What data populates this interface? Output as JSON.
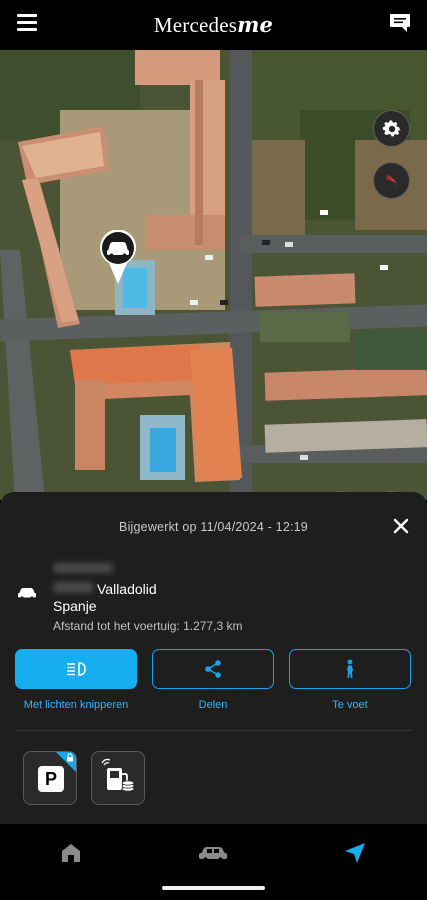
{
  "header": {
    "brand_main": "Mercedes",
    "brand_suffix": "me",
    "menu_icon": "hamburger-menu-icon",
    "chat_icon": "chat-bubble-icon"
  },
  "map": {
    "buttons": {
      "settings": "gear-icon",
      "compass": "compass-icon",
      "vehicle_location": "car-pin-icon",
      "my_location": "crosshair-icon"
    },
    "vehicle_marker": "car-marker-icon"
  },
  "sheet": {
    "updated": "Bijgewerkt op 11/04/2024 - 12:19",
    "address_city": "Valladolid",
    "address_country": "Spanje",
    "distance": "Afstand tot het voertuig: 1.277,3 km",
    "actions": [
      {
        "label": "Met lichten knipperen",
        "icon": "headlight-flash-icon"
      },
      {
        "label": "Delen",
        "icon": "share-icon"
      },
      {
        "label": "Te voet",
        "icon": "walking-person-icon"
      }
    ],
    "tiles": [
      {
        "text": "P",
        "icon": "parking-icon",
        "badge": "lock-icon"
      },
      {
        "icon": "fuel-payment-icon"
      }
    ]
  },
  "nav": {
    "items": [
      "home-icon",
      "car-icon",
      "navigation-arrow-icon"
    ],
    "active": 2
  },
  "colors": {
    "accent": "#17aef0",
    "sheet_bg": "#1e1e1e",
    "background": "#000000"
  }
}
